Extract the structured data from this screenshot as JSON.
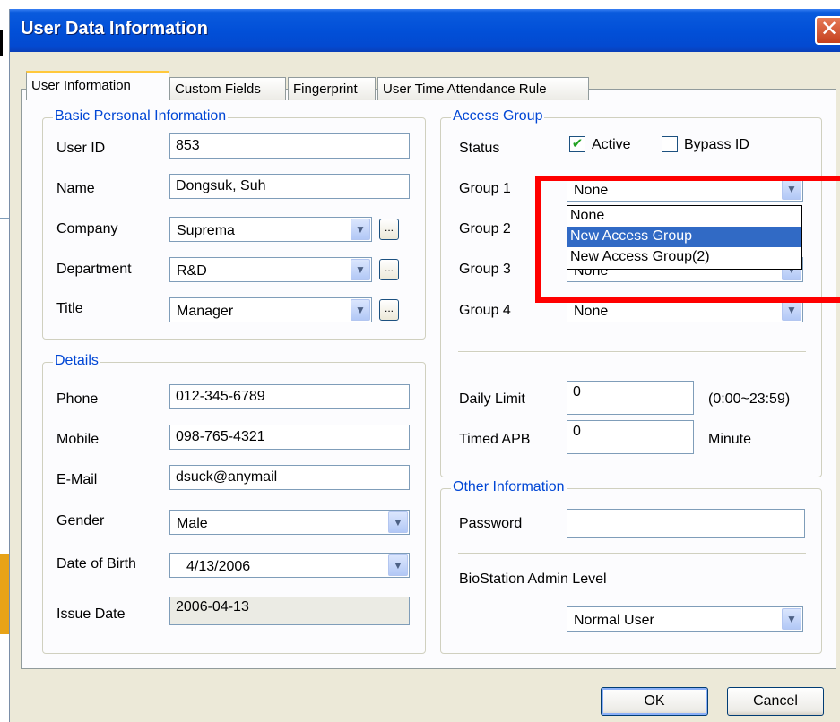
{
  "window": {
    "title": "User Data Information",
    "close_icon": "close-icon"
  },
  "tabs": [
    {
      "label": "User Information",
      "active": true
    },
    {
      "label": "Custom Fields"
    },
    {
      "label": "Fingerprint"
    },
    {
      "label": "User Time Attendance Rule"
    }
  ],
  "basic": {
    "legend": "Basic Personal Information",
    "user_id_label": "User ID",
    "user_id": "853",
    "name_label": "Name",
    "name": "Dongsuk, Suh",
    "company_label": "Company",
    "company": "Suprema",
    "department_label": "Department",
    "department": "R&D",
    "title_label": "Title",
    "title": "Manager",
    "browse": "..."
  },
  "details": {
    "legend": "Details",
    "phone_label": "Phone",
    "phone": "012-345-6789",
    "mobile_label": "Mobile",
    "mobile": "098-765-4321",
    "email_label": "E-Mail",
    "email": "dsuck@anymail",
    "gender_label": "Gender",
    "gender": "Male",
    "dob_label": "Date of Birth",
    "dob": "4/13/2006",
    "issue_label": "Issue Date",
    "issue": "2006-04-13"
  },
  "access": {
    "legend": "Access Group",
    "status_label": "Status",
    "active_label": "Active",
    "active_checked": true,
    "bypass_label": "Bypass ID",
    "bypass_checked": false,
    "group1_label": "Group 1",
    "group1": "None",
    "group2_label": "Group 2",
    "group3_label": "Group 3",
    "group3": "None",
    "group4_label": "Group 4",
    "group4": "None",
    "dropdown_options": [
      "None",
      "New Access Group",
      "New Access Group(2)"
    ],
    "dropdown_selected": "New Access Group",
    "daily_limit_label": "Daily Limit",
    "daily_limit": "0",
    "daily_limit_hint": "(0:00~23:59)",
    "timed_apb_label": "Timed APB",
    "timed_apb": "0",
    "timed_apb_unit": "Minute"
  },
  "other": {
    "legend": "Other Information",
    "password_label": "Password",
    "password": "",
    "admin_level_label": "BioStation Admin Level",
    "admin_level": "Normal User"
  },
  "buttons": {
    "ok": "OK",
    "cancel": "Cancel"
  },
  "colors": {
    "highlight": "#ff0000",
    "title_bar": "#0250d8",
    "legend_text": "#0046d5",
    "selection": "#316ac5"
  }
}
